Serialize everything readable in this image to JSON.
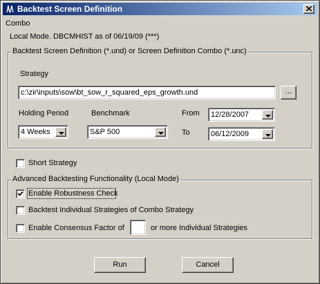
{
  "window": {
    "title": "Backtest Screen Definition",
    "close_glyph": "x",
    "icon": "app-icon"
  },
  "mode_label": "Combo",
  "status_line": "Local Mode. DBCMHIST as of 06/19/09 (***)",
  "definition_group": {
    "label": "Backtest Screen Definition (*.und) or Screen Definition Combo (*.unc)",
    "strategy_label": "Strategy",
    "strategy_path": "c:\\zir\\inputs\\sow\\bt_sow_r_squared_eps_growth.und",
    "browse_label": "...",
    "holding_period_label": "Holding Period",
    "holding_period_value": "4 Weeks",
    "benchmark_label": "Benchmark",
    "benchmark_value": "S&P 500",
    "from_label": "From",
    "from_value": "12/28/2007",
    "to_label": "To",
    "to_value": "06/12/2009"
  },
  "short_strategy": {
    "label": "Short Strategy",
    "checked": false
  },
  "advanced_group": {
    "label": "Advanced Backtesting Functionality (Local Mode)",
    "robustness": {
      "label": "Enable Robustness Check",
      "checked": true
    },
    "individual": {
      "label": "Backtest Individual Strategies of Combo Strategy",
      "checked": false
    },
    "consensus": {
      "label": "Enable Consensus Factor of",
      "value": "",
      "suffix": "or more Individual Strategies",
      "checked": false
    }
  },
  "buttons": {
    "run": "Run",
    "cancel": "Cancel"
  }
}
